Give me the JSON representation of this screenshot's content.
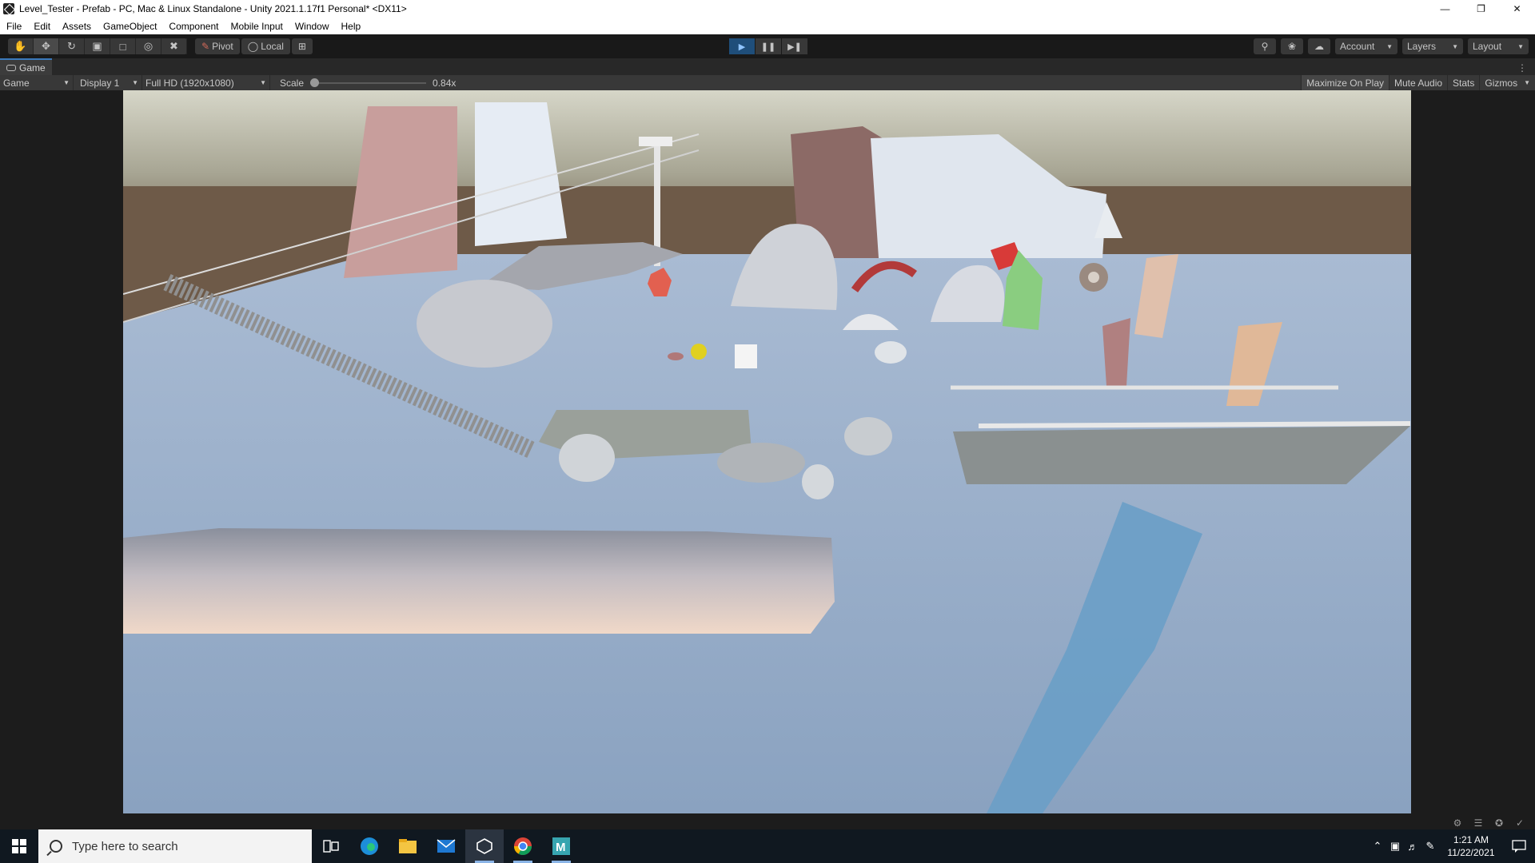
{
  "window": {
    "title": "Level_Tester - Prefab - PC, Mac & Linux Standalone - Unity 2021.1.17f1 Personal* <DX11>",
    "controls": [
      "minimize-icon",
      "restore-icon",
      "close-icon"
    ]
  },
  "menu": {
    "items": [
      "File",
      "Edit",
      "Assets",
      "GameObject",
      "Component",
      "Mobile Input",
      "Window",
      "Help"
    ]
  },
  "toolbar": {
    "tools": [
      "hand-tool-icon",
      "move-tool-icon",
      "rotate-tool-icon",
      "scale-tool-icon",
      "rect-tool-icon",
      "transform-tool-icon",
      "custom-tool-icon"
    ],
    "pivot_label": "Pivot",
    "local_label": "Local",
    "playback": [
      "play-icon",
      "pause-icon",
      "step-icon"
    ],
    "account_label": "Account",
    "layers_label": "Layers",
    "layout_label": "Layout"
  },
  "game_tab": {
    "label": "Game"
  },
  "game_bar": {
    "view_select": "Game",
    "display_select": "Display 1",
    "resolution_select": "Full HD (1920x1080)",
    "scale_label": "Scale",
    "scale_value": "0.84x",
    "scale_level": 0.0,
    "maximize_label": "Maximize On Play",
    "mute_label": "Mute Audio",
    "stats_label": "Stats",
    "gizmos_label": "Gizmos"
  },
  "taskbar": {
    "search_placeholder": "Type here to search",
    "apps": [
      "task-view-icon",
      "edge-icon",
      "file-explorer-icon",
      "mail-icon",
      "unity-icon",
      "chrome-icon",
      "maya-icon"
    ],
    "time": "1:21 AM",
    "date": "11/22/2021"
  },
  "colors": {
    "accent": "#3a79bb",
    "editor_bg": "#191919",
    "sky_top": "#b6b8a6",
    "ground": "#8da4c2"
  }
}
